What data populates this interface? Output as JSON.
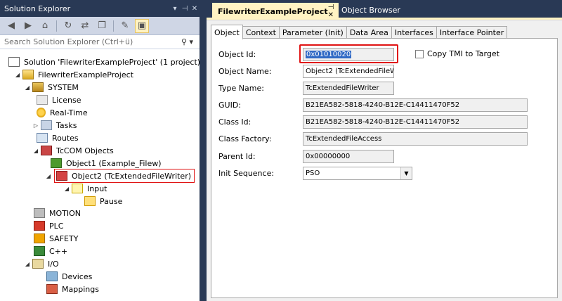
{
  "solution_explorer": {
    "title": "Solution Explorer",
    "title_buttons": [
      "▾",
      "⊣",
      "✕"
    ],
    "search_placeholder": "Search Solution Explorer (Ctrl+ü)",
    "tree": [
      {
        "label": "Solution 'FilewriterExampleProject' (1 project)",
        "icon": "solution-icon"
      },
      {
        "label": "FilewriterExampleProject",
        "icon": "project-icon"
      },
      {
        "label": "SYSTEM",
        "icon": "system-icon"
      },
      {
        "label": "License",
        "icon": "license-icon"
      },
      {
        "label": "Real-Time",
        "icon": "realtime-icon"
      },
      {
        "label": "Tasks",
        "icon": "tasks-icon"
      },
      {
        "label": "Routes",
        "icon": "routes-icon"
      },
      {
        "label": "TcCOM Objects",
        "icon": "tccom-icon"
      },
      {
        "label": "Object1 (Example_Filew)",
        "icon": "object-icon"
      },
      {
        "label": "Object2 (TcExtendedFileWriter)",
        "icon": "object-icon"
      },
      {
        "label": "Input",
        "icon": "input-icon"
      },
      {
        "label": "Pause",
        "icon": "pause-icon"
      },
      {
        "label": "MOTION",
        "icon": "motion-icon"
      },
      {
        "label": "PLC",
        "icon": "plc-icon"
      },
      {
        "label": "SAFETY",
        "icon": "safety-icon"
      },
      {
        "label": "C++",
        "icon": "cpp-icon"
      },
      {
        "label": "I/O",
        "icon": "io-icon"
      },
      {
        "label": "Devices",
        "icon": "devices-icon"
      },
      {
        "label": "Mappings",
        "icon": "mappings-icon"
      }
    ]
  },
  "editor": {
    "active_tab": "FilewriterExampleProject",
    "tab_close": "⊣ ✕",
    "second_tab": "Object Browser",
    "property_tabs": [
      "Object",
      "Context",
      "Parameter (Init)",
      "Data Area",
      "Interfaces",
      "Interface Pointer"
    ],
    "object": {
      "object_id_label": "Object Id:",
      "object_id": "0x01010020",
      "copy_tmi_label": "Copy TMI to Target",
      "object_name_label": "Object Name:",
      "object_name": "Object2 (TcExtendedFileW",
      "type_name_label": "Type Name:",
      "type_name": "TcExtendedFileWriter",
      "guid_label": "GUID:",
      "guid": "B21EA582-5818-4240-B12E-C14411470F52",
      "class_id_label": "Class Id:",
      "class_id": "B21EA582-5818-4240-B12E-C14411470F52",
      "class_factory_label": "Class Factory:",
      "class_factory": "TcExtendedFileAccess",
      "parent_id_label": "Parent Id:",
      "parent_id": "0x00000000",
      "init_sequence_label": "Init Sequence:",
      "init_sequence": "PSO"
    }
  }
}
